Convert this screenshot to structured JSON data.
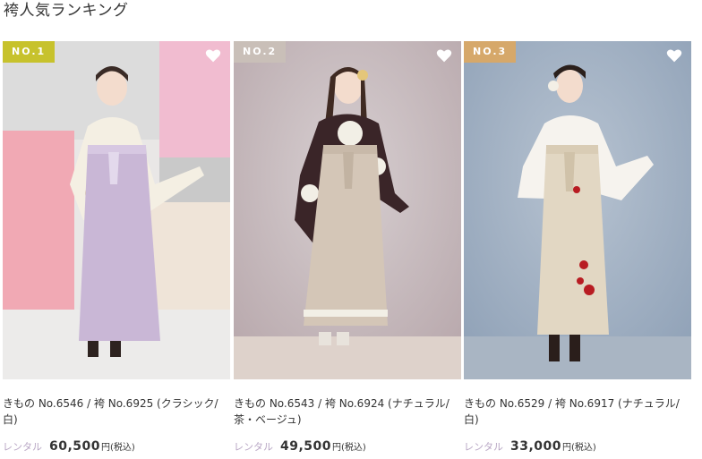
{
  "section": {
    "title": "袴人気ランキング"
  },
  "rankings": [
    {
      "badge": "NO.1",
      "badge_color": "#c7c22c",
      "caption": "きもの No.6546 / 袴 No.6925 (クラシック/白)",
      "rental_label": "レンタル",
      "price": "60,500",
      "unit": "円(税込)",
      "favorite_icon": "heart-outline-icon"
    },
    {
      "badge": "NO.2",
      "badge_color": "#c9bfb8",
      "caption": "きもの No.6543 / 袴 No.6924 (ナチュラル/茶・ベージュ)",
      "rental_label": "レンタル",
      "price": "49,500",
      "unit": "円(税込)",
      "favorite_icon": "heart-outline-icon"
    },
    {
      "badge": "NO.3",
      "badge_color": "#d6a86a",
      "caption": "きもの No.6529 / 袴 No.6917 (ナチュラル/白)",
      "rental_label": "レンタル",
      "price": "33,000",
      "unit": "円(税込)",
      "favorite_icon": "heart-outline-icon"
    }
  ]
}
